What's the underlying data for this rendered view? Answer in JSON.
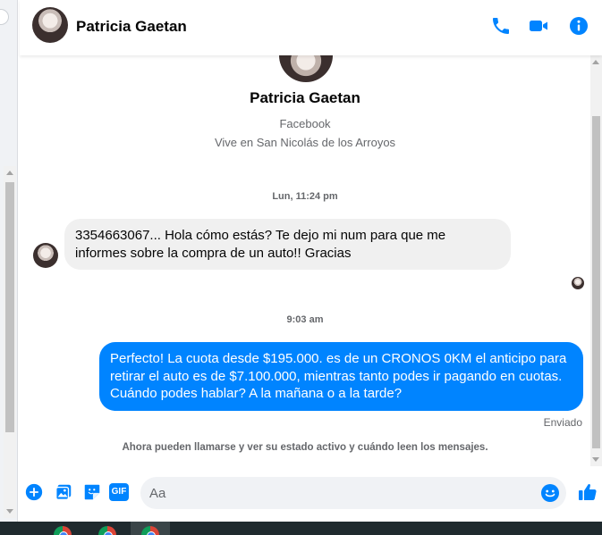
{
  "header": {
    "contact_name": "Patricia Gaetan",
    "icons": [
      "phone-icon",
      "video-camera-icon",
      "info-icon"
    ]
  },
  "profile": {
    "name": "Patricia Gaetan",
    "source": "Facebook",
    "location": "Vive en San Nicolás de los Arroyos"
  },
  "messages": [
    {
      "timestamp": "Lun, 11:24 pm",
      "direction": "incoming",
      "text": "3354663067... Hola cómo estás? Te dejo mi num para que me informes sobre la compra de un auto!! Gracias"
    },
    {
      "timestamp": "9:03 am",
      "direction": "outgoing",
      "text": "Perfecto! La cuota desde $195.000. es de un CRONOS 0KM el anticipo para retirar el auto es de $7.100.000, mientras tanto podes ir pagando en cuotas. Cuándo podes hablar? A la mañana o a la tarde?",
      "status": "Enviado"
    }
  ],
  "notice": "Ahora pueden llamarse y ver su estado activo y cuándo leen los mensajes.",
  "composer": {
    "placeholder": "Aa",
    "gif_label": "GIF",
    "tools": [
      "add-icon",
      "photo-icon",
      "sticker-icon",
      "gif-icon"
    ]
  },
  "colors": {
    "accent": "#0084ff",
    "incoming_bubble": "#f0f0f0",
    "secondary_text": "#65676b"
  }
}
